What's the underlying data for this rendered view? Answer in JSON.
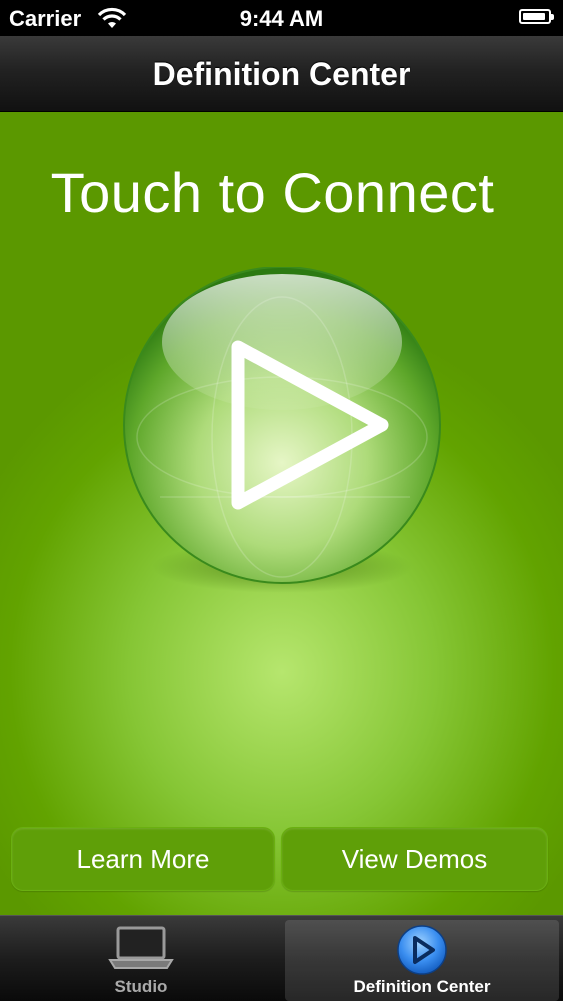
{
  "status_bar": {
    "carrier": "Carrier",
    "time": "9:44 AM",
    "battery_level": 0.9
  },
  "nav": {
    "title": "Definition Center"
  },
  "main": {
    "headline": "Touch to Connect",
    "learn_more_label": "Learn More",
    "view_demos_label": "View Demos"
  },
  "tab_bar": {
    "tabs": [
      {
        "label": "Studio",
        "icon": "laptop-icon",
        "selected": false
      },
      {
        "label": "Definition Center",
        "icon": "play-circle-icon",
        "selected": true
      }
    ]
  },
  "colors": {
    "accent_green": "#6ab010",
    "tab_selected_blue": "#3a8ef0"
  }
}
